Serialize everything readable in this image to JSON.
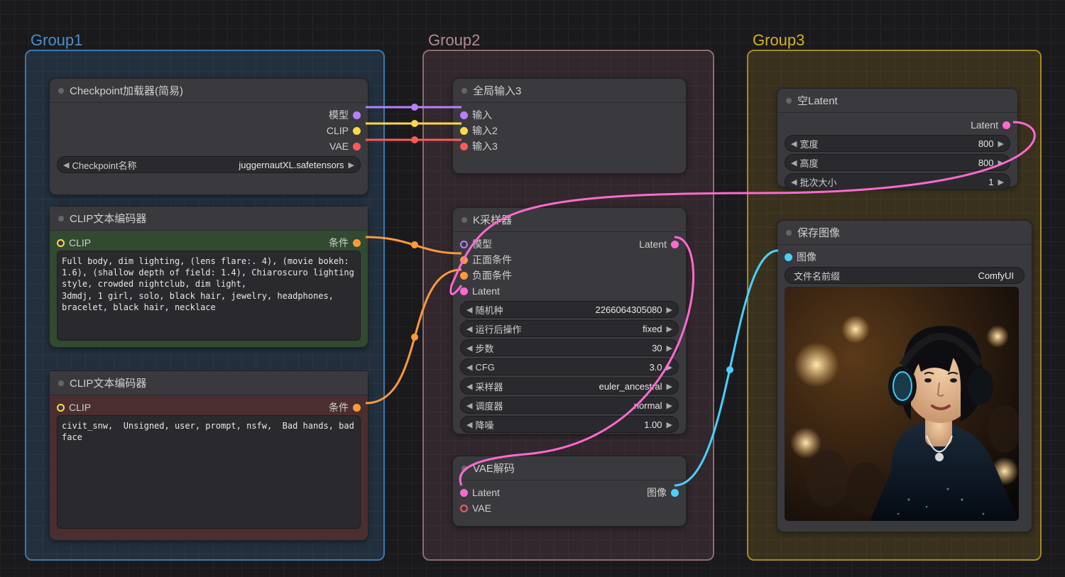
{
  "groups": {
    "g1": "Group1",
    "g2": "Group2",
    "g3": "Group3"
  },
  "checkpoint": {
    "title": "Checkpoint加载器(简易)",
    "outputs": {
      "model": "模型",
      "clip": "CLIP",
      "vae": "VAE"
    },
    "widget": {
      "label": "Checkpoint名称",
      "value": "juggernautXL.safetensors"
    }
  },
  "clip_pos": {
    "title": "CLIP文本编码器",
    "input": "CLIP",
    "output": "条件",
    "text": "Full body, dim lighting, (lens flare:. 4), (movie bokeh: 1.6), (shallow depth of field: 1.4), Chiaroscuro lighting style, crowded nightclub, dim light,\n3dmdj, 1 girl, solo, black hair, jewelry, headphones, bracelet, black hair, necklace"
  },
  "clip_neg": {
    "title": "CLIP文本编码器",
    "input": "CLIP",
    "output": "条件",
    "text": "civit_snw,  Unsigned, user, prompt, nsfw,  Bad hands, bad face"
  },
  "global_in": {
    "title": "全局输入3",
    "inputs": {
      "i1": "输入",
      "i2": "输入2",
      "i3": "输入3"
    }
  },
  "ksampler": {
    "title": "K采样器",
    "inputs": {
      "model": "模型",
      "positive": "正面条件",
      "negative": "负面条件",
      "latent": "Latent"
    },
    "output": "Latent",
    "params": {
      "seed": {
        "label": "随机种",
        "value": "2266064305080"
      },
      "control": {
        "label": "运行后操作",
        "value": "fixed"
      },
      "steps": {
        "label": "步数",
        "value": "30"
      },
      "cfg": {
        "label": "CFG",
        "value": "3.0"
      },
      "sampler": {
        "label": "采样器",
        "value": "euler_ancestral"
      },
      "scheduler": {
        "label": "调度器",
        "value": "normal"
      },
      "denoise": {
        "label": "降噪",
        "value": "1.00"
      }
    }
  },
  "vae_decode": {
    "title": "VAE解码",
    "inputs": {
      "latent": "Latent",
      "vae": "VAE"
    },
    "output": "图像"
  },
  "empty_latent": {
    "title": "空Latent",
    "output": "Latent",
    "params": {
      "width": {
        "label": "宽度",
        "value": "800"
      },
      "height": {
        "label": "高度",
        "value": "800"
      },
      "batch": {
        "label": "批次大小",
        "value": "1"
      }
    }
  },
  "save_image": {
    "title": "保存图像",
    "input": "图像",
    "widget": {
      "label": "文件名前缀",
      "value": "ComfyUI"
    }
  }
}
